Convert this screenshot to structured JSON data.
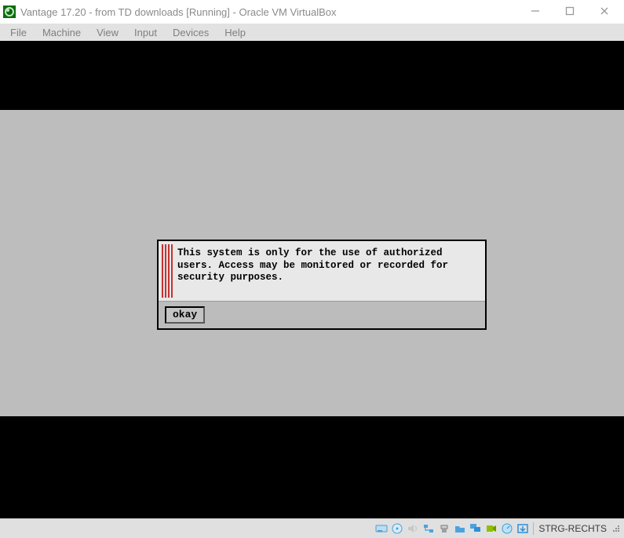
{
  "window": {
    "title": "Vantage 17.20 - from TD downloads [Running] - Oracle VM VirtualBox"
  },
  "menubar": {
    "items": [
      "File",
      "Machine",
      "View",
      "Input",
      "Devices",
      "Help"
    ]
  },
  "dialog": {
    "message": "This system is only for the use of authorized users. Access may be monitored or recorded for security purposes.",
    "ok_label": "okay"
  },
  "statusbar": {
    "hostkey": "STRG-RECHTS",
    "icons": [
      {
        "name": "harddisk-icon",
        "color": "#5aa6e0"
      },
      {
        "name": "optical-disc-icon",
        "color": "#5aa6e0"
      },
      {
        "name": "audio-icon",
        "color": "#b0b0b0"
      },
      {
        "name": "network-icon",
        "color": "#4aa3e0"
      },
      {
        "name": "usb-icon",
        "color": "#7a7a7a"
      },
      {
        "name": "shared-folder-icon",
        "color": "#4aa3e0"
      },
      {
        "name": "display-icon",
        "color": "#4aa3e0"
      },
      {
        "name": "recording-icon",
        "color": "#7fb600"
      },
      {
        "name": "cpu-icon",
        "color": "#3aa0e0"
      },
      {
        "name": "mouse-integration-icon",
        "color": "#2f8fd8"
      }
    ]
  }
}
